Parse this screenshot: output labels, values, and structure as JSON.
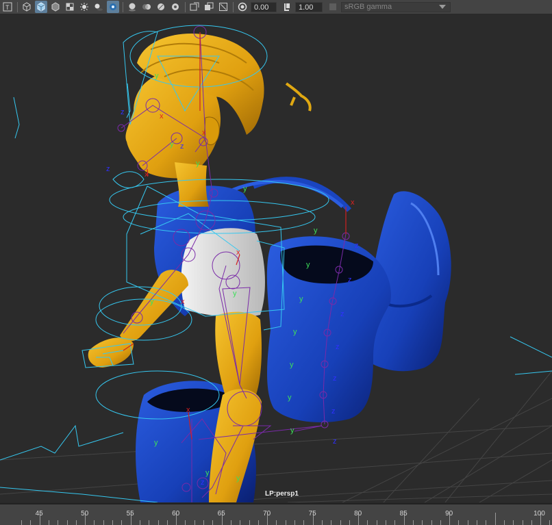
{
  "toolbar": {
    "icons": [
      "wireframe-icon",
      "smooth-shade-icon",
      "default-material-icon",
      "textured-icon",
      "all-lights-icon",
      "shadows-icon",
      "bounding-box-icon",
      "xray-icon",
      "xray-joints-icon",
      "ambient-occlusion-icon",
      "motion-blur-icon",
      "anti-alias-icon",
      "depth-of-field-icon",
      "isolate-select-icon",
      "screen-space-ao-icon",
      "film-gate-icon",
      "exposure-icon",
      "gamma-icon"
    ],
    "exposure_value": "0.00",
    "gamma_value": "1.00",
    "color_space": "sRGB gamma"
  },
  "viewport": {
    "camera_label": "LP:persp1",
    "axis_labels": {
      "y": "y",
      "z": "z",
      "x": "x"
    },
    "colors": {
      "background": "#2b2b2b",
      "skin": "#e8a712",
      "backpack": "#1740b8",
      "shirt": "#d9d9d9",
      "controls": "#36c8f0",
      "joints": "#6b2aa0"
    }
  },
  "timeslider": {
    "frames": [
      "45",
      "50",
      "55",
      "60",
      "65",
      "70",
      "75",
      "80",
      "85",
      "90",
      "100"
    ]
  }
}
